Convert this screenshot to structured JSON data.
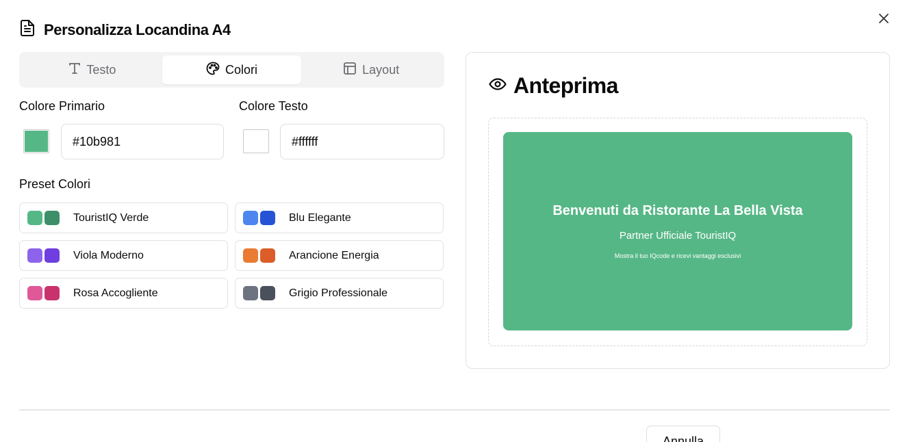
{
  "dialog": {
    "title": "Personalizza Locandina A4"
  },
  "tabs": [
    {
      "label": "Testo",
      "icon": "type-icon",
      "active": false
    },
    {
      "label": "Colori",
      "icon": "palette-icon",
      "active": true
    },
    {
      "label": "Layout",
      "icon": "layout-icon",
      "active": false
    }
  ],
  "colors": {
    "primary": {
      "label": "Colore Primario",
      "value": "#10b981",
      "swatch": "#56b786"
    },
    "text": {
      "label": "Colore Testo",
      "value": "#ffffff",
      "swatch": "#ffffff"
    }
  },
  "presets": {
    "title": "Preset Colori",
    "items": [
      {
        "label": "TouristIQ Verde",
        "c1": "#56b786",
        "c2": "#3c8f69"
      },
      {
        "label": "Blu Elegante",
        "c1": "#4d86ef",
        "c2": "#2653d6"
      },
      {
        "label": "Viola Moderno",
        "c1": "#8c64ec",
        "c2": "#6e3ee0"
      },
      {
        "label": "Arancione Energia",
        "c1": "#ea7b33",
        "c2": "#db5e29"
      },
      {
        "label": "Rosa Accogliente",
        "c1": "#df5897",
        "c2": "#c9336d"
      },
      {
        "label": "Grigio Professionale",
        "c1": "#6e7380",
        "c2": "#4a505c"
      }
    ]
  },
  "preview": {
    "heading": "Anteprima",
    "poster": {
      "background": "#56b786",
      "text_color": "#ffffff",
      "title": "Benvenuti da Ristorante La Bella Vista",
      "subtitle": "Partner Ufficiale TouristIQ",
      "note": "Mostra il tuo IQcode e ricevi vantaggi esclusivi"
    }
  },
  "footer": {
    "cancel_label": "Annulla"
  }
}
